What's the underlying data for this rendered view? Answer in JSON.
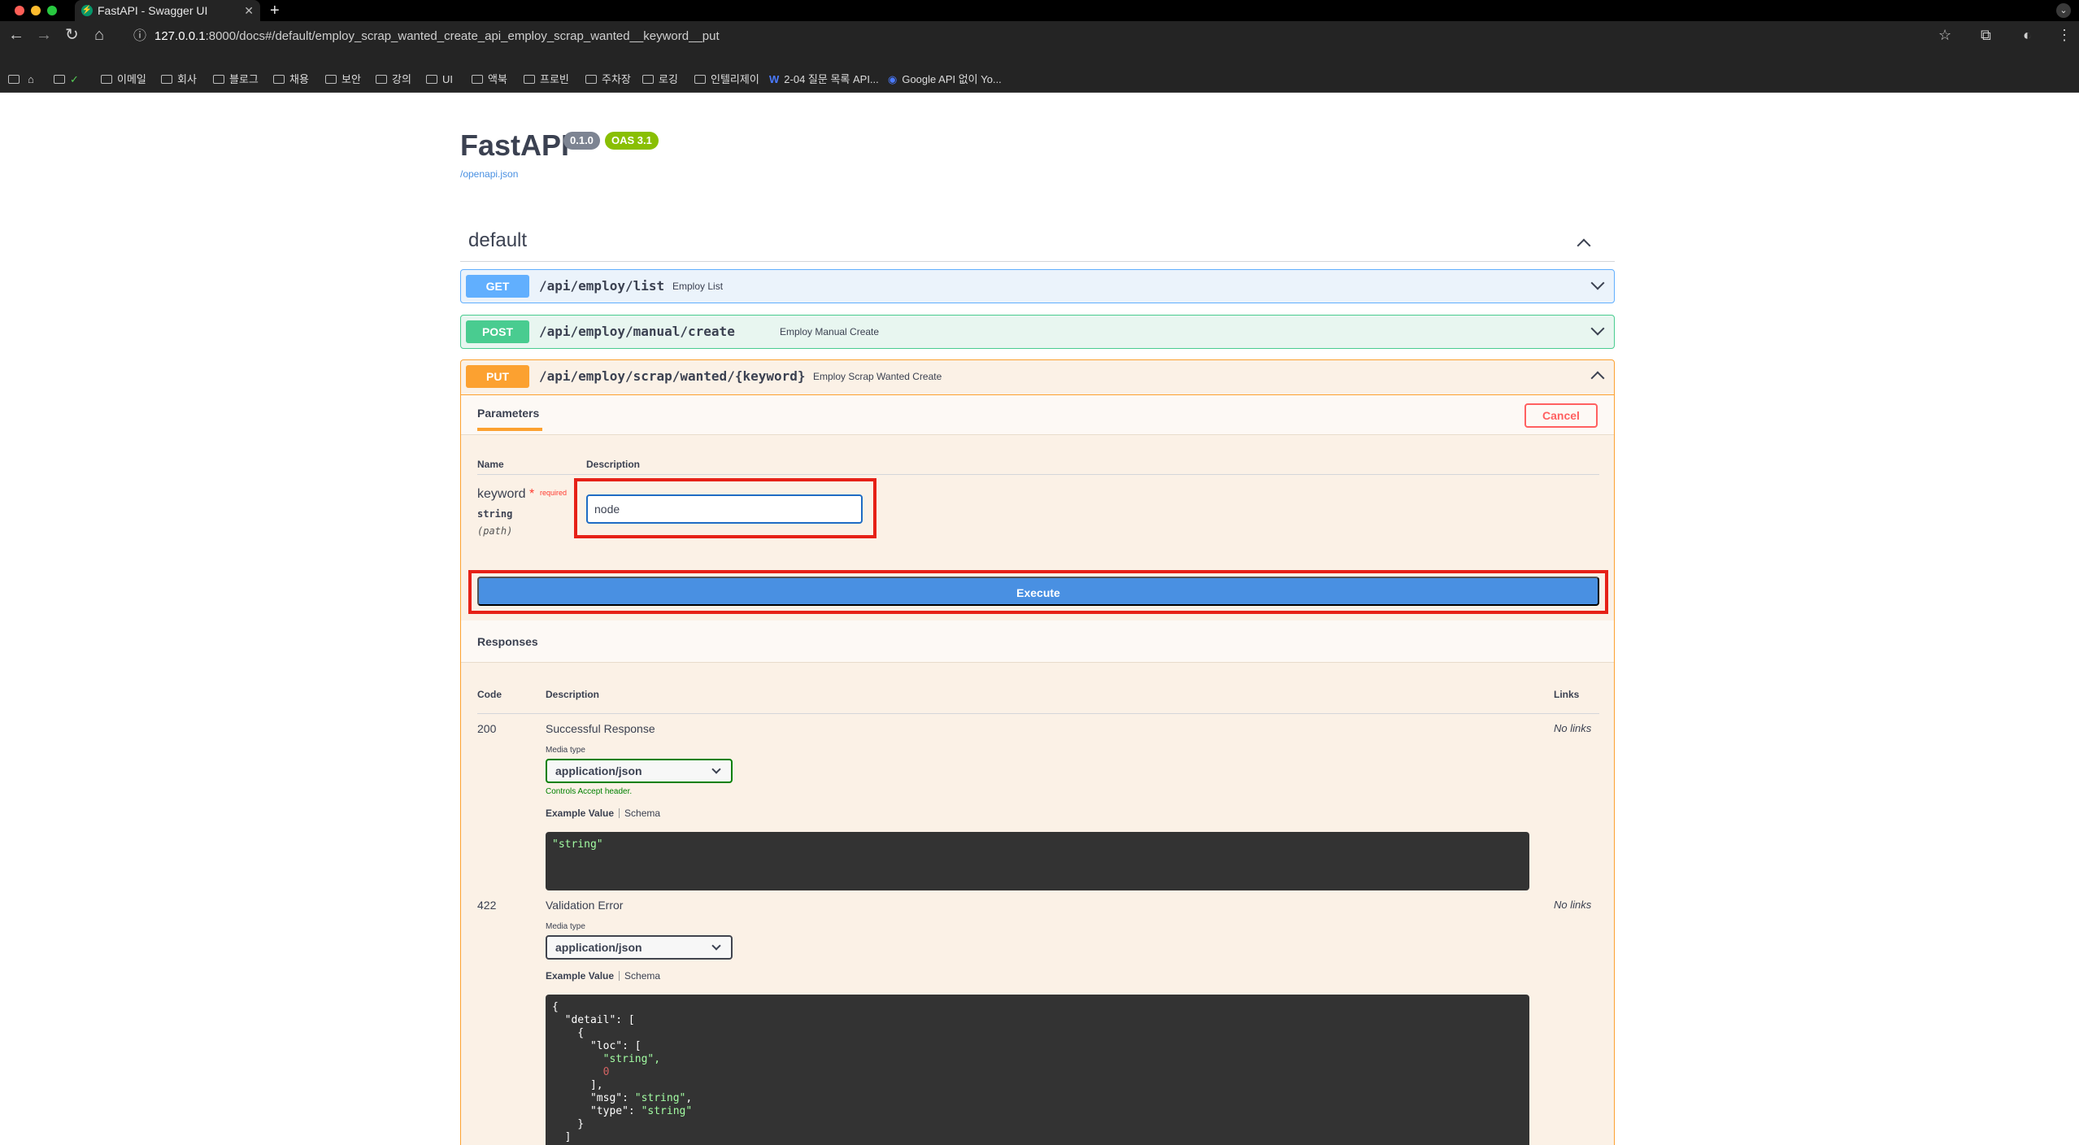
{
  "browser": {
    "tab_title": "FastAPI - Swagger UI",
    "tab_favicon": "⚡",
    "url_host": "127.0.0.1",
    "url_rest": ":8000/docs#/default/employ_scrap_wanted_create_api_employ_scrap_wanted__keyword__put",
    "bookmarks": [
      "이메일",
      "회사",
      "블로그",
      "채용",
      "보안",
      "강의",
      "UI",
      "액북",
      "프로빈",
      "주차장",
      "로깅",
      "인텔리제이",
      "2-04 질문 목록 API...",
      "Google API 없이 Yo..."
    ]
  },
  "header": {
    "title": "FastAPI",
    "version_badge": "0.1.0",
    "oas_badge": "OAS 3.1",
    "openapi_link": "/openapi.json"
  },
  "section": {
    "title": "default"
  },
  "endpoints": [
    {
      "method": "GET",
      "path": "/api/employ/list",
      "summary": "Employ List"
    },
    {
      "method": "POST",
      "path": "/api/employ/manual/create",
      "summary": "Employ Manual Create"
    },
    {
      "method": "PUT",
      "path": "/api/employ/scrap/wanted/{keyword}",
      "summary": "Employ Scrap Wanted Create"
    }
  ],
  "put_detail": {
    "tab": "Parameters",
    "cancel": "Cancel",
    "col_name": "Name",
    "col_description": "Description",
    "param": {
      "name": "keyword",
      "required_star": "*",
      "required_text": "required",
      "type": "string",
      "in": "(path)",
      "value": "node"
    },
    "execute": "Execute",
    "responses_title": "Responses",
    "resp_col_code": "Code",
    "resp_col_description": "Description",
    "resp_col_links": "Links",
    "responses": [
      {
        "code": "200",
        "description": "Successful Response",
        "links": "No links",
        "media_label": "Media type",
        "media_value": "application/json",
        "controls_text": "Controls Accept header.",
        "example_tab": "Example Value",
        "schema_tab": "Schema",
        "example": "\"string\""
      },
      {
        "code": "422",
        "description": "Validation Error",
        "links": "No links",
        "media_label": "Media type",
        "media_value": "application/json",
        "example_tab": "Example Value",
        "schema_tab": "Schema",
        "example_lines": [
          "{",
          "  \"detail\": [",
          "    {",
          "      \"loc\": [",
          "        \"string\",",
          "        0",
          "      ],",
          "      \"msg\": \"string\",",
          "      \"type\": \"string\"",
          "    }",
          "  ]"
        ]
      }
    ]
  },
  "colors": {
    "get": "#61affe",
    "post": "#49cc90",
    "put": "#fca130",
    "execute": "#4990e2",
    "highlight": "#e62117"
  }
}
